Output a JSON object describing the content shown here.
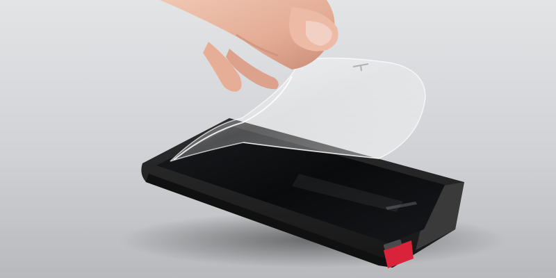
{
  "scene": {
    "subject": "phone-screen-protector-peeling",
    "colors": {
      "background_top": "#e2e3e5",
      "background_bottom": "#b9bbbe",
      "case": "#232323",
      "case_edge": "#3a3a3a",
      "screen": "#0d0e10",
      "accent_red": "#d8233a",
      "skin": "#e7b6a1",
      "skin_shadow": "#c98c77",
      "film": "#ffffff"
    }
  }
}
